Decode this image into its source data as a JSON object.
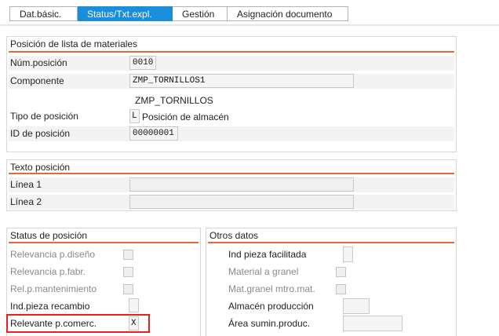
{
  "tabs": [
    "Dat.básic.",
    "Status/Txt.expl.",
    "Gestión",
    "Asignación documento"
  ],
  "active_tab": 1,
  "materials": {
    "title": "Posición de lista de materiales",
    "num_posicion_label": "Núm.posición",
    "num_posicion_value": "0010",
    "componente_label": "Componente",
    "componente_value": "ZMP_TORNILLOS1",
    "componente_desc": "ZMP_TORNILLOS",
    "tipo_label": "Tipo de posición",
    "tipo_value": "L",
    "tipo_desc": "Posición de almacén",
    "id_label": "ID de posición",
    "id_value": "00000001"
  },
  "texto": {
    "title": "Texto posición",
    "linea1_label": "Línea 1",
    "linea1_value": "",
    "linea2_label": "Línea 2",
    "linea2_value": ""
  },
  "status": {
    "title": "Status de posición",
    "relev_diseno": "Relevancia p.diseño",
    "relev_fabr": "Relevancia p.fabr.",
    "rel_mant": "Rel.p.mantenimiento",
    "ind_recambio": "Ind.pieza recambio",
    "relev_comerc": "Relevante p.comerc.",
    "relev_comerc_value": "X"
  },
  "otros": {
    "title": "Otros datos",
    "ind_facilitada": "Ind pieza facilitada",
    "mat_granel": "Material a granel",
    "mat_granel_mtro": "Mat.granel mtro.mat.",
    "almacen_prod": "Almacén producción",
    "area_sumin": "Área sumin.produc."
  },
  "colors": {
    "accent": "#1a8ddb",
    "section_rule": "#e06a3b",
    "highlight": "#e8211d"
  }
}
